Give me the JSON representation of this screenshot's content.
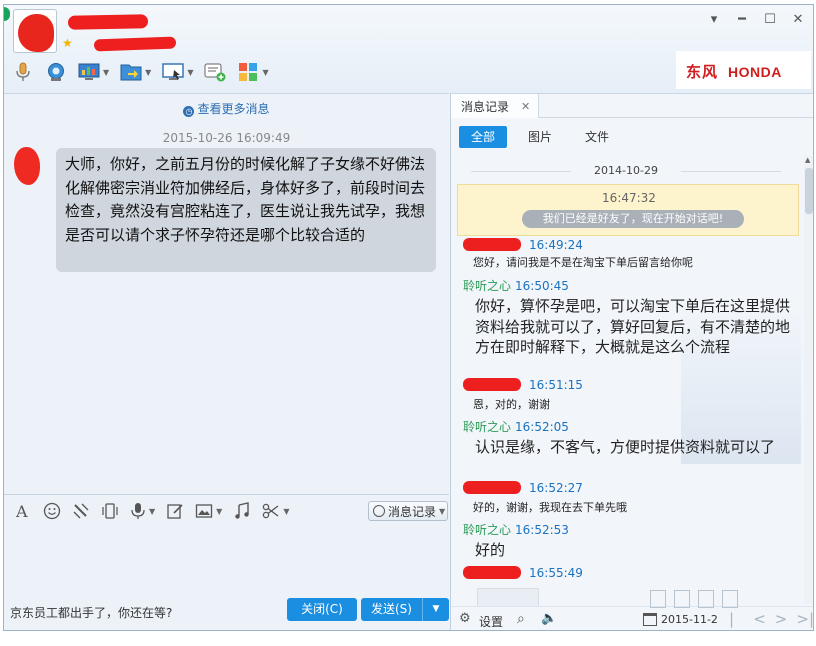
{
  "window": {
    "contact_name": "",
    "signature": "",
    "brand_chinese": "东风",
    "brand_english": "HONDA"
  },
  "toolbar": {
    "icons": [
      "microphone-icon",
      "webcam-icon",
      "remote-desktop-icon",
      "file-transfer-icon",
      "screen-share-icon",
      "add-note-icon",
      "apps-grid-icon"
    ]
  },
  "chat": {
    "view_more": "查看更多消息",
    "timestamp": "2015-10-26 16:09:49",
    "message": "大师，你好，之前五月份的时候化解了子女缘不好佛法化解佛密宗消业符加佛经后，身体好多了，前段时间去检查，竟然没有宫腔粘连了，医生说让我先试孕，我想是否可以请个求子怀孕符还是哪个比较合适的"
  },
  "editor": {
    "history_button": "消息记录",
    "tip": "京东员工都出手了，你还在等?",
    "close_button": "关闭(C)",
    "send_button": "发送(S)"
  },
  "history": {
    "tab_title": "消息记录",
    "filters": [
      "全部",
      "图片",
      "文件"
    ],
    "date_separator": "2014-10-29",
    "system_time": "16:47:32",
    "system_message": "我们已经是好友了，现在开始对话吧!",
    "messages": [
      {
        "sender": "",
        "time": "16:49:24",
        "text": "您好，请问我是不是在淘宝下单后留言给你呢"
      },
      {
        "sender": "聆听之心",
        "time": "16:50:45",
        "text": "你好，算怀孕是吧，可以淘宝下单后在这里提供资料给我就可以了，算好回复后，有不清楚的地方在即时解释下，大概就是这么个流程"
      },
      {
        "sender": "",
        "time": "16:51:15",
        "text": "恩，对的，谢谢"
      },
      {
        "sender": "聆听之心",
        "time": "16:52:05",
        "text": "认识是缘，不客气，方便时提供资料就可以了"
      },
      {
        "sender": "",
        "time": "16:52:27",
        "text": "好的，谢谢，我现在去下单先哦"
      },
      {
        "sender": "聆听之心",
        "time": "16:52:53",
        "text": "好的"
      },
      {
        "sender": "",
        "time": "16:55:49",
        "text": ""
      }
    ],
    "settings_label": "设置",
    "bottom_date": "2015-11-2"
  }
}
